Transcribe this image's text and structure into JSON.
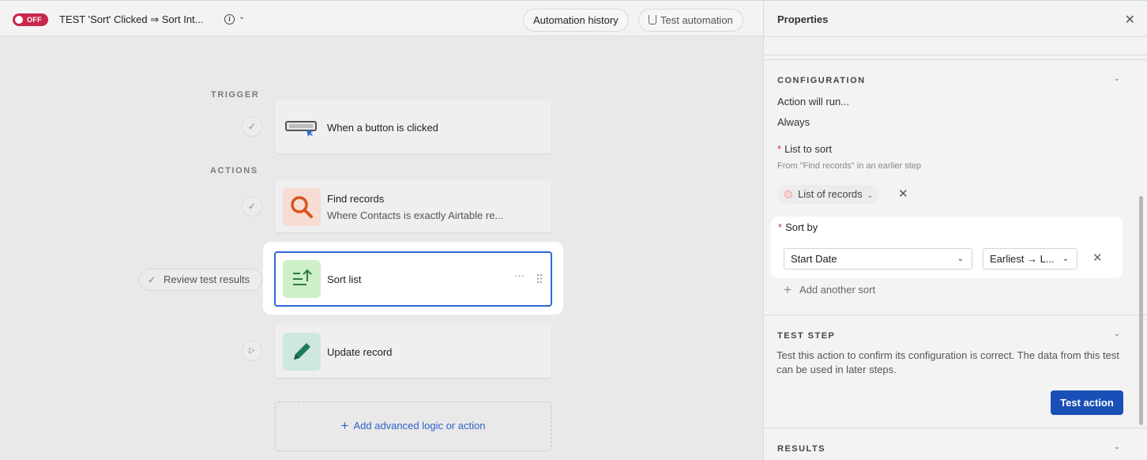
{
  "header": {
    "toggle_label": "OFF",
    "title": "TEST 'Sort' Clicked ⇒ Sort Int...",
    "info_icon": "i",
    "history_label": "Automation history",
    "test_label": "Test automation"
  },
  "canvas": {
    "trigger_label": "TRIGGER",
    "actions_label": "ACTIONS",
    "trigger_card": {
      "title": "When a button is clicked"
    },
    "steps": [
      {
        "title": "Find records",
        "subtitle": "Where Contacts is exactly Airtable re..."
      },
      {
        "title": "Sort list"
      },
      {
        "title": "Update record"
      }
    ],
    "review_label": "Review test results",
    "add_label": "Add advanced logic or action"
  },
  "panel": {
    "title": "Properties",
    "config_header": "CONFIGURATION",
    "action_will_run": "Action will run...",
    "always": "Always",
    "list_to_sort_label": "List to sort",
    "list_to_sort_hint": "From \"Find records\" in an earlier step",
    "list_pill": "List of records",
    "sort_by_label": "Sort by",
    "sort_field": "Start Date",
    "sort_order": "Earliest → L...",
    "add_sort_label": "Add another sort",
    "test_header": "TEST STEP",
    "test_desc": "Test this action to confirm its configuration is correct. The data from this test can be used in later steps.",
    "test_button": "Test action",
    "results_header": "RESULTS"
  },
  "colors": {
    "accent_blue": "#1b4fb8",
    "selection_border": "#2d6ad8",
    "toggle_red": "#c9274a",
    "find_icon_bg": "#f6dcd2",
    "sort_icon_bg": "#cdf0c9",
    "update_icon_bg": "#cfe8df"
  }
}
